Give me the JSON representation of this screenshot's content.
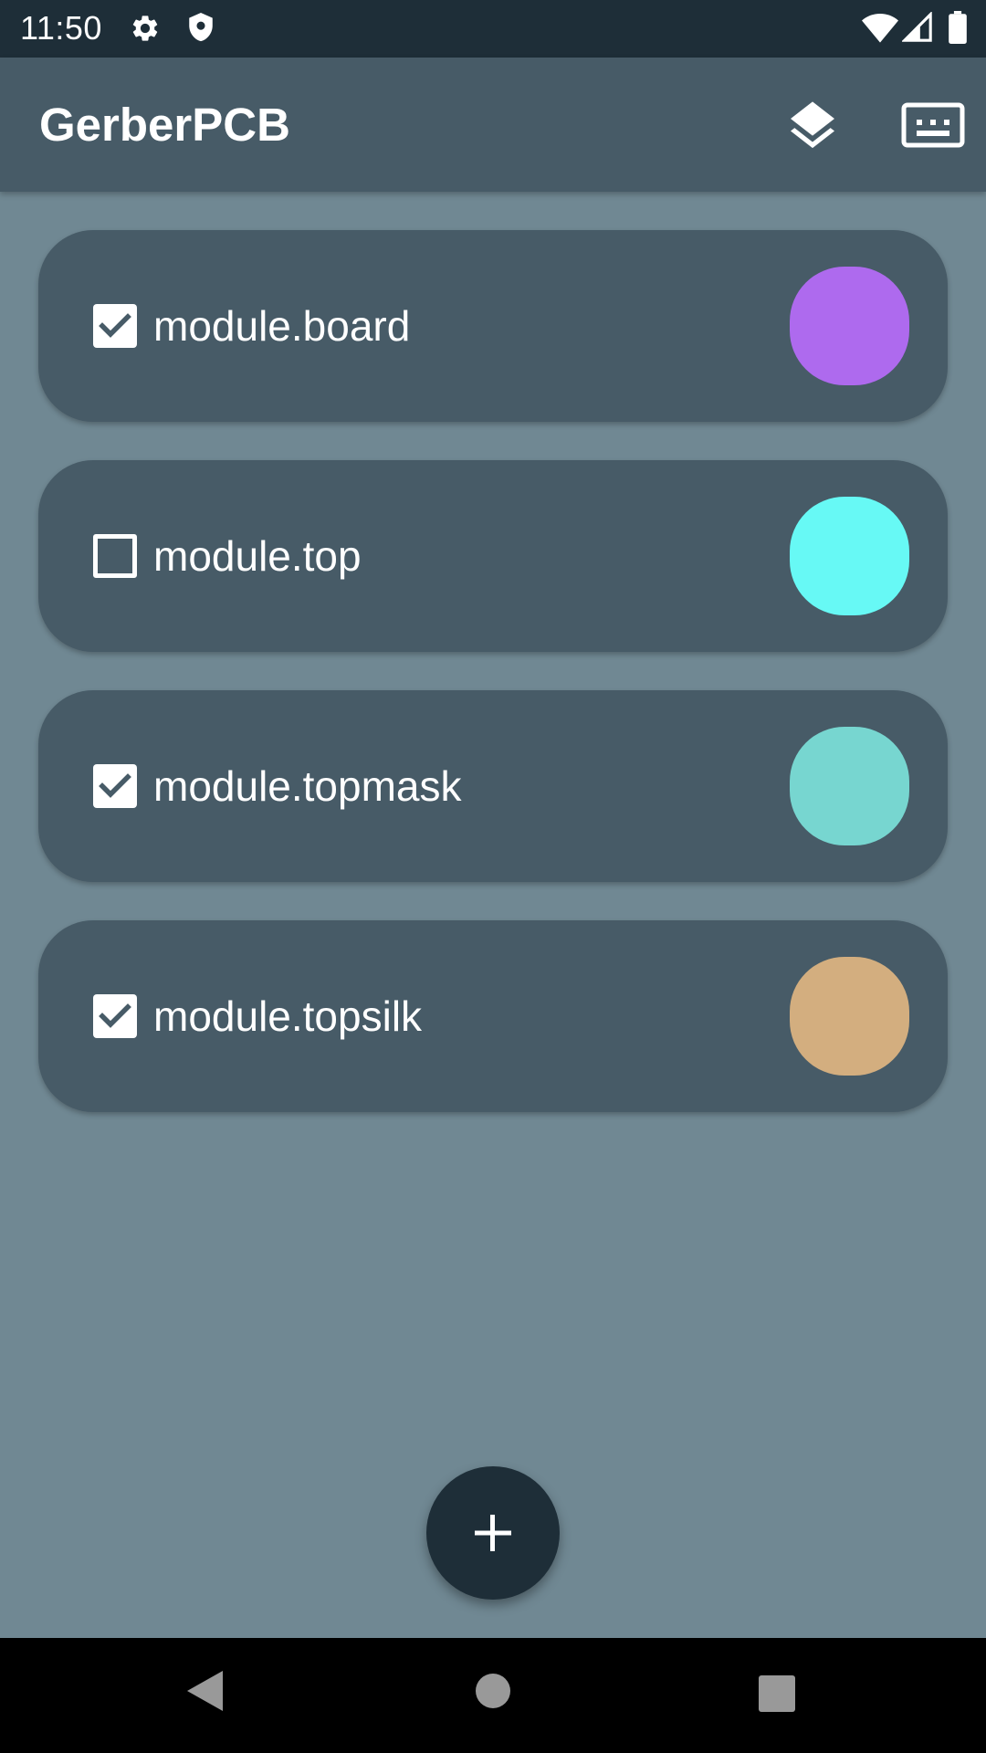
{
  "status_bar": {
    "time": "11:50",
    "icons": [
      "gear-icon",
      "shield-icon",
      "wifi-icon",
      "signal-icon",
      "battery-icon"
    ]
  },
  "app_bar": {
    "title": "GerberPCB",
    "actions": [
      "layers-icon",
      "keyboard-icon"
    ]
  },
  "layers": [
    {
      "name": "module.board",
      "checked": true,
      "color": "#ae6aee"
    },
    {
      "name": "module.top",
      "checked": false,
      "color": "#67f9f5"
    },
    {
      "name": "module.topmask",
      "checked": true,
      "color": "#77d6d0"
    },
    {
      "name": "module.topsilk",
      "checked": true,
      "color": "#d3ae7f"
    }
  ],
  "fab": {
    "icon": "plus-icon"
  },
  "nav_bar": {
    "icons": [
      "back-icon",
      "home-icon",
      "recents-icon"
    ]
  },
  "colors": {
    "background": "#708893",
    "app_bar": "#475b67",
    "card": "#475b67",
    "status_bar": "#1e2e38",
    "fab": "#1e2e38"
  }
}
